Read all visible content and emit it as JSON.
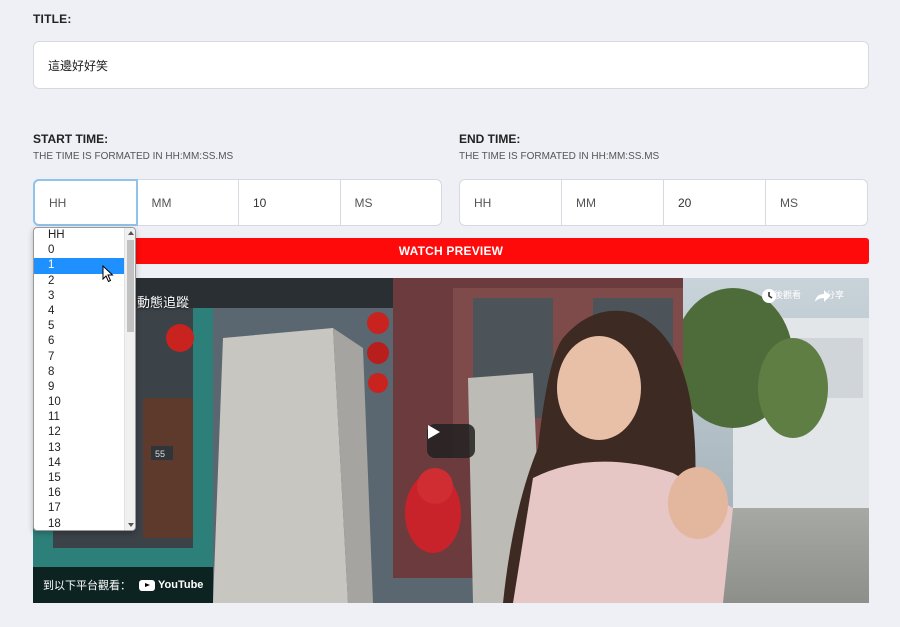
{
  "title_field": {
    "label": "TITLE:",
    "value": "這邊好好笑"
  },
  "start_time": {
    "label": "START TIME:",
    "hint": "THE TIME IS FORMATED IN HH:MM:SS.MS",
    "hh": "HH",
    "mm": "MM",
    "ss": "10",
    "ms": "MS"
  },
  "end_time": {
    "label": "END TIME:",
    "hint": "THE TIME IS FORMATED IN HH:MM:SS.MS",
    "hh": "HH",
    "mm": "MM",
    "ss": "20",
    "ms": "MS"
  },
  "watch_button": "WATCH PREVIEW",
  "video": {
    "title": "動態追蹤",
    "watch_later": "稍後觀看",
    "share": "分享",
    "watch_on": "到以下平台觀看：",
    "youtube": "YouTube",
    "sign_number": "55"
  },
  "dropdown": {
    "options": [
      "HH",
      "0",
      "1",
      "2",
      "3",
      "4",
      "5",
      "6",
      "7",
      "8",
      "9",
      "10",
      "11",
      "12",
      "13",
      "14",
      "15",
      "16",
      "17",
      "18"
    ],
    "selected": "1"
  },
  "colors": {
    "accent_red": "#ff0a0a",
    "select_blue": "#1e90ff",
    "focus_border": "#90c2ea"
  }
}
